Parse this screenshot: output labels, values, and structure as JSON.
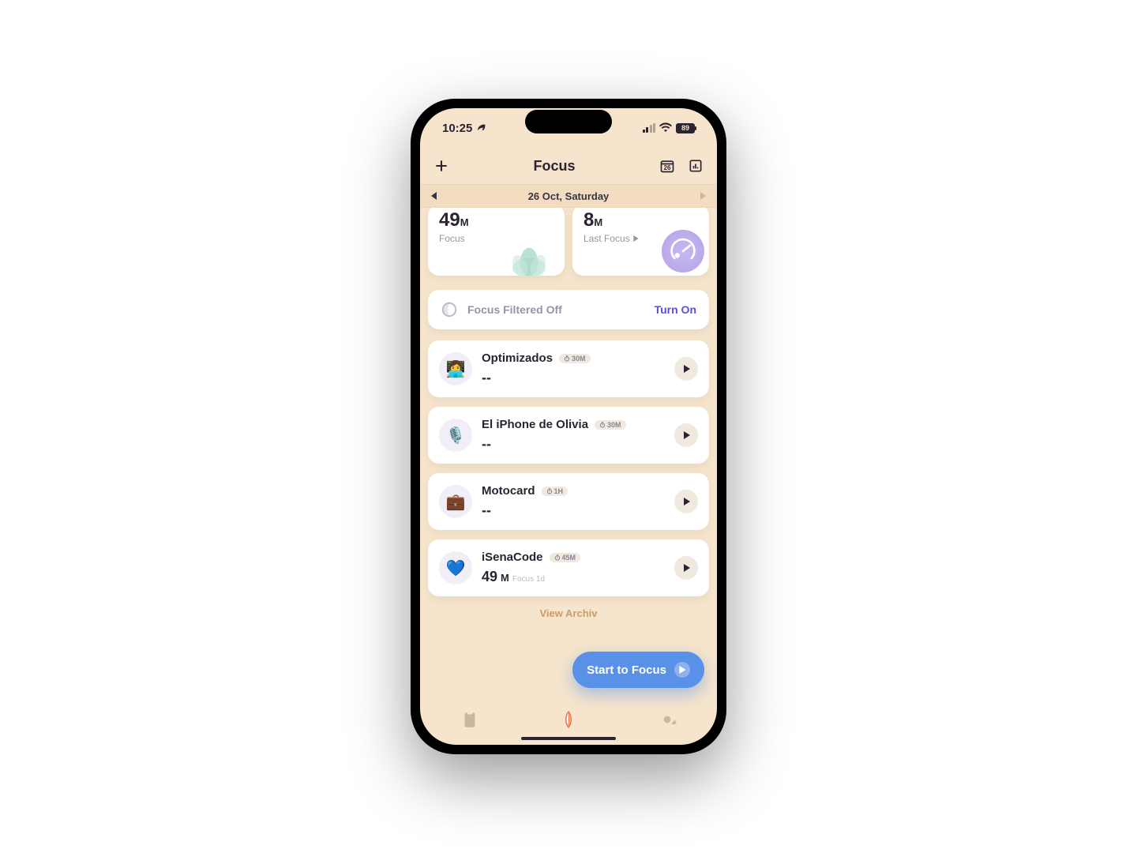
{
  "status": {
    "time": "10:25",
    "battery": "89"
  },
  "header": {
    "title": "Focus"
  },
  "date": {
    "label": "26 Oct, Saturday",
    "calendar_day": "26"
  },
  "stats": {
    "focus": {
      "value": "49",
      "unit": "M",
      "label": "Focus"
    },
    "last": {
      "value": "8",
      "unit": "M",
      "label": "Last Focus"
    }
  },
  "filter": {
    "label": "Focus Filtered Off",
    "action": "Turn On"
  },
  "items": [
    {
      "emoji": "👩‍💻",
      "title": "Optimizados",
      "duration": "30M",
      "value": "--",
      "sub": ""
    },
    {
      "emoji": "🎙️",
      "title": "El iPhone de Olivia",
      "duration": "30M",
      "value": "--",
      "sub": ""
    },
    {
      "emoji": "💼",
      "title": "Motocard",
      "duration": "1H",
      "value": "--",
      "sub": ""
    },
    {
      "emoji": "💙",
      "title": "iSenaCode",
      "duration": "45M",
      "value": "49",
      "unit": "M",
      "sub": "Focus 1d"
    }
  ],
  "archived": "View Archiv",
  "cta": "Start to Focus"
}
